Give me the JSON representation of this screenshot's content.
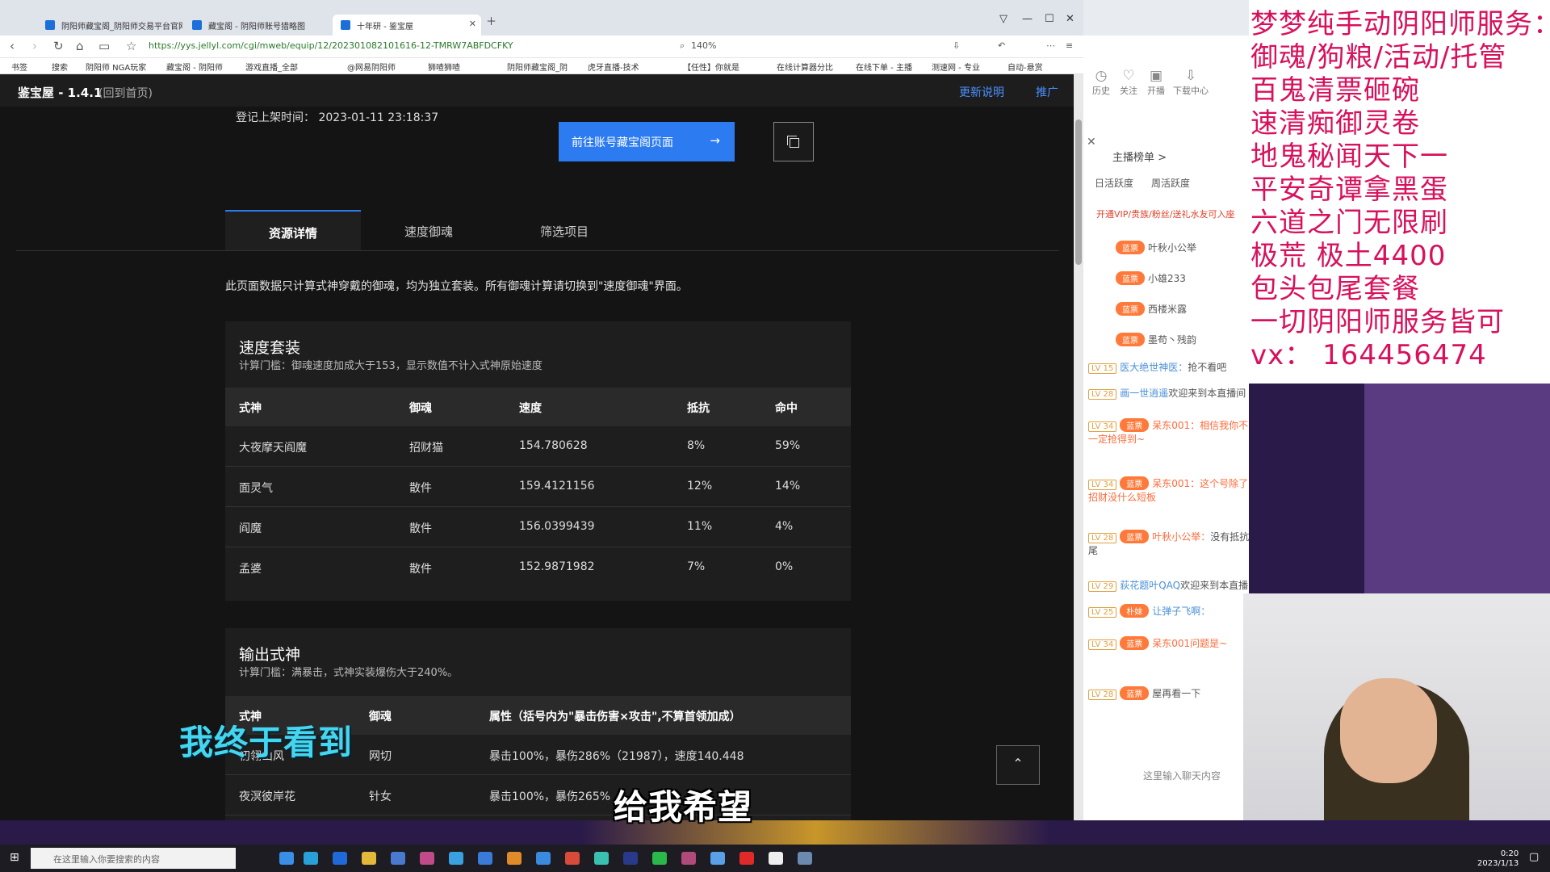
{
  "browser": {
    "tabs": [
      "阴阳师藏宝阁_阴阳师交易平台官网",
      "藏宝阁 - 阴阳师账号猎略图",
      "十年研 - 鉴宝屋"
    ],
    "url": "https://yys.jellyl.com/cgi/mweb/equip/12/202301082101616-12-TMRW7ABFDCFKY",
    "zoom": "140%",
    "bookmarks": [
      "书签",
      "搜索",
      "阴阳师 NGA玩家",
      "藏宝阁 - 阴阳师",
      "游戏直播_全部",
      "@网易阴阳师",
      "狮喳狮喳",
      "阴阳师藏宝阁_阴",
      "虎牙直播-技术",
      "【任性】你就是",
      "在线计算器分比",
      "在线下单 - 主播",
      "测速网 - 专业",
      "自动-悬赏"
    ]
  },
  "site": {
    "brand": "鉴宝屋 - 1.4.1",
    "back": "(回到首页)",
    "links": [
      "更新说明",
      "推广"
    ],
    "reg_time": "登记上架时间：  2023-01-11 23:18:37",
    "go_button": "前往账号藏宝阁页面",
    "tabs": [
      "资源详情",
      "速度御魂",
      "筛选项目"
    ],
    "note": "此页面数据只计算式神穿戴的御魂，均为独立套装。所有御魂计算请切换到\"速度御魂\"界面。",
    "speed": {
      "title": "速度套装",
      "sub": "计算门槛：御魂速度加成大于153，显示数值不计入式神原始速度",
      "headers": [
        "式神",
        "御魂",
        "速度",
        "抵抗",
        "命中"
      ],
      "rows": [
        [
          "大夜摩天阎魔",
          "招财猫",
          "154.780628",
          "8%",
          "59%"
        ],
        [
          "面灵气",
          "散件",
          "159.4121156",
          "12%",
          "14%"
        ],
        [
          "阎魔",
          "散件",
          "156.0399439",
          "11%",
          "4%"
        ],
        [
          "孟婆",
          "散件",
          "152.9871982",
          "7%",
          "0%"
        ]
      ]
    },
    "output": {
      "title": "输出式神",
      "sub": "计算门槛：满暴击，式神实装爆伤大于240%。",
      "headers": [
        "式神",
        "御魂",
        "属性（括号内为\"暴击伤害×攻击\",不算首领加成）"
      ],
      "rows": [
        [
          "初翎山风",
          "网切",
          "暴击100%，暴伤286%（21987），速度140.448"
        ],
        [
          "夜溟彼岸花",
          "针女",
          "暴击100%，暴伤265%"
        ]
      ]
    }
  },
  "subtitles": [
    "我终于看到",
    "给我希望"
  ],
  "stream": {
    "side_icons": [
      "历史",
      "关注",
      "开播",
      "下载中心"
    ],
    "anchor_rank": "主播榜单 >",
    "rank_tabs": [
      "日活跃度",
      "周活跃度"
    ],
    "vip_line": "开通VIP/贵族/粉丝/送礼水友可入座",
    "chat": [
      {
        "lv": "",
        "badge": "蓝票",
        "name": "叶秋小公举",
        "msg": ""
      },
      {
        "lv": "",
        "badge": "蓝票",
        "name": "小雄233",
        "msg": ""
      },
      {
        "lv": "",
        "badge": "蓝票",
        "name": "西楼米露",
        "msg": ""
      },
      {
        "lv": "",
        "badge": "蓝票",
        "name": "墨苟丶残韵",
        "msg": ""
      },
      {
        "lv": "LV 15",
        "badge": "",
        "name": "医大绝世神医：",
        "msg": "抢不看吧"
      },
      {
        "lv": "LV 28",
        "badge": "",
        "name": "画一世逍遥",
        "msg": "欢迎来到本直播间"
      },
      {
        "lv": "LV 34",
        "badge": "蓝票",
        "name": "呆东001：",
        "msg": "相信我你不一定抢得到~"
      },
      {
        "lv": "LV 34",
        "badge": "蓝票",
        "name": "呆东001：",
        "msg": "这个号除了招财没什么短板"
      },
      {
        "lv": "LV 28",
        "badge": "蓝票",
        "name": "叶秋小公举：",
        "msg": "没有抵抗尾"
      },
      {
        "lv": "LV 29",
        "badge": "",
        "name": "荻花题叶QAQ",
        "msg": "欢迎来到本直播间"
      },
      {
        "lv": "LV 25",
        "badge": "朴妹",
        "name": "让弹子飞啊：",
        "msg": ""
      },
      {
        "lv": "LV 34",
        "badge": "蓝票",
        "name": "呆东001",
        "msg": "问题是~"
      },
      {
        "lv": "LV 28",
        "badge": "蓝票",
        "name": "",
        "msg": "屋再看一下"
      }
    ],
    "input_placeholder": "这里输入聊天内容",
    "ad": [
      "梦梦纯手动阴阳师服务：",
      "御魂/狗粮/活动/托管",
      "百鬼清票砸碗",
      "速清痴御灵卷",
      "地鬼秘闻天下一",
      "平安奇谭拿黑蛋",
      "六道之门无限刷",
      "极荒 极土4400",
      "包头包尾套餐",
      "一切阴阳师服务皆可",
      "vx：  164456474"
    ]
  },
  "taskbar": {
    "search": "在这里输入你要搜索的内容",
    "time": "0:20",
    "date": "2023/1/13"
  }
}
